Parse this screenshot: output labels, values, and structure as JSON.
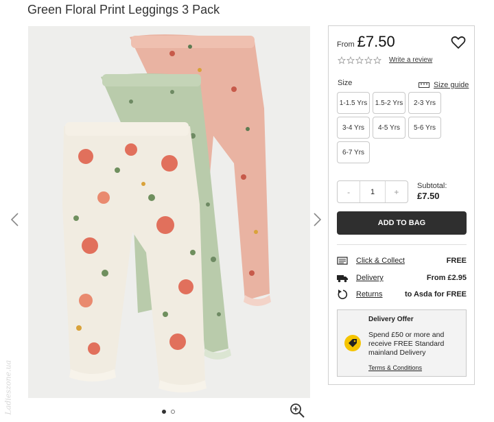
{
  "product": {
    "title": "Green Floral Print Leggings 3 Pack",
    "image_alt": "Three pairs of floral leggings in cream, green and pink",
    "image_count": 2,
    "active_image": 1
  },
  "price": {
    "from_label": "From",
    "amount": "£7.50"
  },
  "reviews": {
    "rating": 0,
    "max_rating": 5,
    "write_review_label": "Write a review"
  },
  "size": {
    "label": "Size",
    "guide_label": "Size guide",
    "options": [
      "1-1.5 Yrs",
      "1.5-2 Yrs",
      "2-3 Yrs",
      "3-4 Yrs",
      "4-5 Yrs",
      "5-6 Yrs",
      "6-7 Yrs"
    ]
  },
  "quantity": {
    "minus": "-",
    "value": "1",
    "plus": "+"
  },
  "subtotal": {
    "label": "Subtotal:",
    "amount": "£7.50"
  },
  "add_to_bag_label": "ADD TO BAG",
  "delivery": {
    "rows": [
      {
        "icon": "click-collect-icon",
        "label": "Click & Collect",
        "value": "FREE"
      },
      {
        "icon": "delivery-truck-icon",
        "label": "Delivery",
        "value": "From £2.95"
      },
      {
        "icon": "returns-icon",
        "label": "Returns",
        "value": "to Asda for FREE"
      }
    ]
  },
  "offer": {
    "title": "Delivery Offer",
    "body": "Spend £50 or more and receive FREE Standard mainland Delivery",
    "terms_label": "Terms & Conditions"
  },
  "watermark": "Ladieszone.ua",
  "colors": {
    "button": "#2f2f2f",
    "offer_badge": "#f5c400",
    "offer_bg": "#f3f3f3",
    "border": "#cfcfcf"
  }
}
